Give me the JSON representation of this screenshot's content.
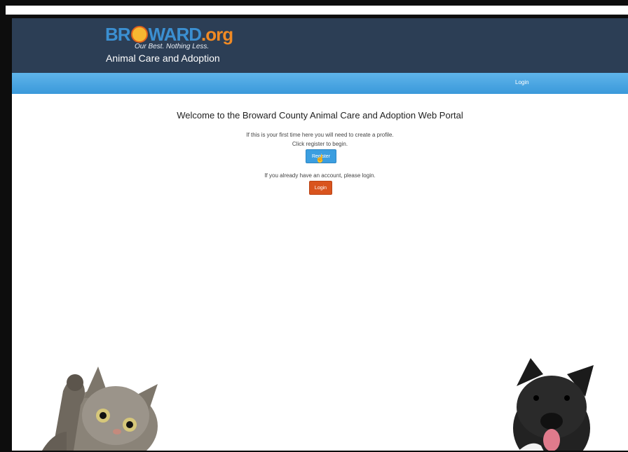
{
  "header": {
    "logo_main": "BR",
    "logo_rest": "WARD",
    "logo_org": ".org",
    "logo_tagline": "Our Best. Nothing Less.",
    "site_title": "Animal Care and Adoption"
  },
  "nav": {
    "login_label": "Login"
  },
  "main": {
    "welcome": "Welcome to the Broward County Animal Care and Adoption Web Portal",
    "first_time_line1": "If this is your first time here you will need to create a profile.",
    "first_time_line2": "Click register to begin.",
    "register_label": "Register",
    "existing_account": "If you already have an account, please login.",
    "login_label": "Login"
  },
  "colors": {
    "header_bg": "#2c3e55",
    "navbar": "#4aa8e3",
    "register_button": "#3b9ee0",
    "login_button": "#d9541e"
  },
  "icons": [
    "pointer-cursor-icon"
  ]
}
